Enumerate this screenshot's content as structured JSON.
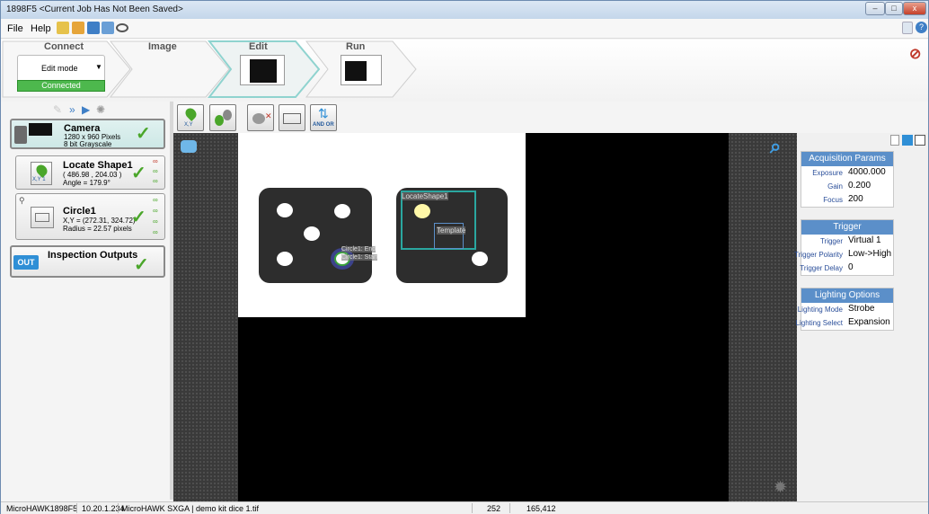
{
  "window": {
    "title": "1898F5 <Current Job Has Not Been Saved>",
    "min": "–",
    "max": "□",
    "close": "x"
  },
  "menu": {
    "file": "File",
    "help": "Help"
  },
  "steps": {
    "connect": "Connect",
    "image": "Image",
    "edit": "Edit",
    "run": "Run"
  },
  "connect": {
    "mode_value": "Edit mode",
    "status": "Connected"
  },
  "tools": [
    {
      "name": "Camera",
      "line1": "1280 x 960 Pixels",
      "line2": "8 bit Grayscale"
    },
    {
      "name": "Locate Shape1",
      "line1": "( 486.98 , 204.03 )",
      "line2": "Angle = 179.9°",
      "icon_text": "X,Y 1"
    },
    {
      "name": "Circle1",
      "line1": "X,Y = (272.31, 324.72)",
      "line2": "Radius = 22.57 pixels"
    },
    {
      "name": "Inspection Outputs",
      "icon_text": "OUT"
    }
  ],
  "toolbar": {
    "xy_label": "X,Y",
    "andor_label": "AND OR"
  },
  "overlay": {
    "locate_label": "LocateShape1",
    "template_label": "Template",
    "circle_end": "Circle1: End",
    "circle_start": "Circle1: Start"
  },
  "acquisition": {
    "header": "Acquisition Params",
    "rows": [
      {
        "k": "Exposure",
        "v": "4000.000"
      },
      {
        "k": "Gain",
        "v": "0.200"
      },
      {
        "k": "Focus",
        "v": "200"
      }
    ]
  },
  "trigger": {
    "header": "Trigger",
    "rows": [
      {
        "k": "Trigger",
        "v": "Virtual 1"
      },
      {
        "k": "Trigger Polarity",
        "v": "Low->High"
      },
      {
        "k": "Trigger Delay",
        "v": "0"
      }
    ]
  },
  "lighting": {
    "header": "Lighting Options",
    "rows": [
      {
        "k": "Lighting Mode",
        "v": "Strobe"
      },
      {
        "k": "Lighting Select",
        "v": "Expansion"
      }
    ]
  },
  "status": {
    "device": "MicroHAWK1898F5",
    "ip": "10.20.1.234",
    "file": "MicroHAWK SXGA | demo kit dice 1.tif",
    "val1": "252",
    "val2": "165,412"
  },
  "colors": {
    "accent": "#5b8fc9",
    "connected": "#4db84d",
    "check": "#4aa62a",
    "overlay": "#2aa7a0"
  }
}
